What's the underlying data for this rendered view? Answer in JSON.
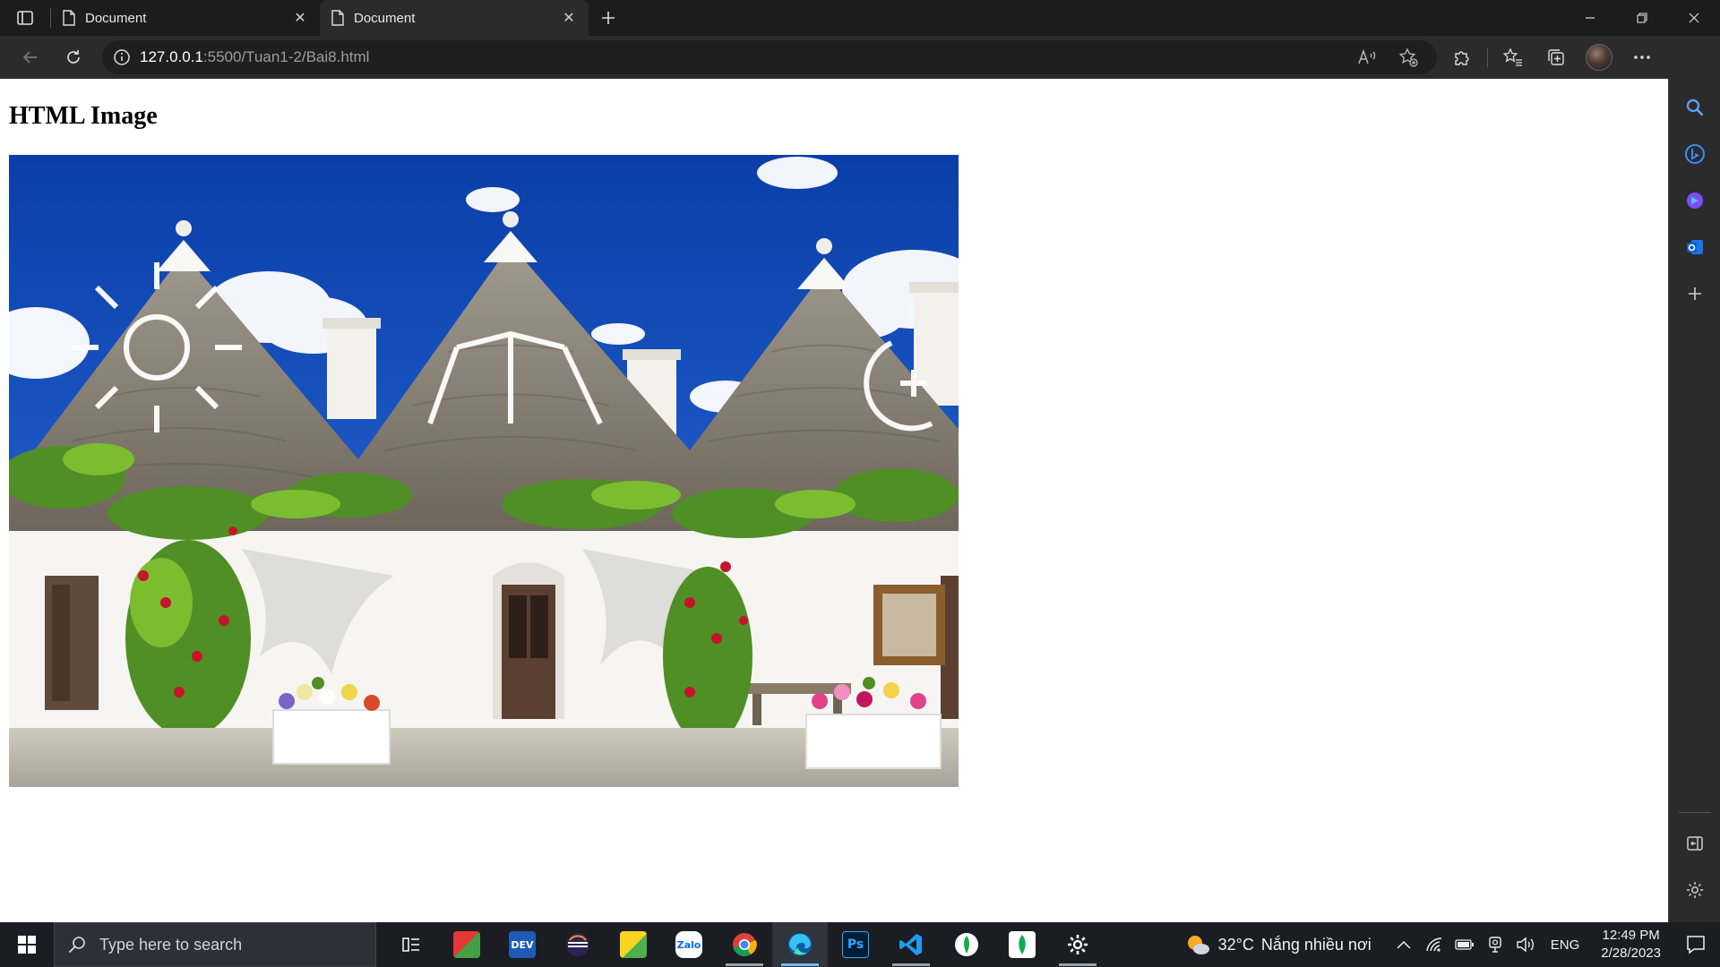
{
  "browser": {
    "tabs": [
      {
        "title": "Document",
        "active": false
      },
      {
        "title": "Document",
        "active": true
      }
    ],
    "url": {
      "host": "127.0.0.1",
      "rest": ":5500/Tuan1-2/Bai8.html"
    }
  },
  "page": {
    "heading": "HTML Image",
    "image_alt": "Trulli houses in Alberobello"
  },
  "taskbar": {
    "search_placeholder": "Type here to search",
    "apps": [
      "task-view",
      "foxit-reader",
      "dev-cpp",
      "eclipse",
      "sticky-notes",
      "zalo",
      "chrome",
      "edge",
      "photoshop",
      "vs-code",
      "mongodb-compass",
      "mongodb",
      "settings"
    ],
    "weather": {
      "temp": "32°C",
      "desc": "Nắng nhiều nơi"
    },
    "language": "ENG",
    "clock": {
      "time": "12:49 PM",
      "date": "2/28/2023"
    }
  }
}
